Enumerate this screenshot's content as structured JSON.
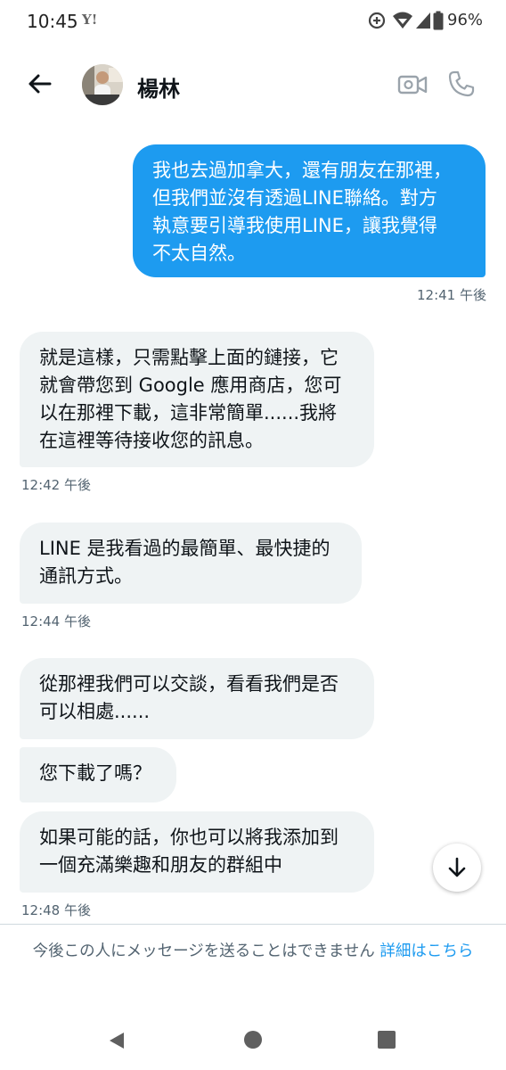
{
  "status_bar": {
    "time": "10:45",
    "carrier_icon_text": "Y!",
    "icons": [
      "data-saver-icon",
      "wifi-icon",
      "signal-icon",
      "battery-icon"
    ],
    "battery": "96%"
  },
  "header": {
    "contact_name": "楊林",
    "icons": {
      "back": "back-arrow-icon",
      "video": "video-call-icon",
      "phone": "phone-icon"
    }
  },
  "messages": [
    {
      "direction": "outgoing",
      "lines": [
        "我也去過加拿大，還有朋友在那裡，",
        "但我們並沒有透過LINE聯絡。對方",
        "執意要引導我使用LINE，讓我覺得",
        "不太自然。"
      ],
      "time": "12:41 午後"
    },
    {
      "direction": "incoming",
      "lines": [
        "就是這樣，只需點擊上面的鏈接，它",
        "就會帶您到 Google 應用商店，您可",
        "以在那裡下載，這非常簡單......我將",
        "在這裡等待接收您的訊息。"
      ],
      "time": "12:42 午後"
    },
    {
      "direction": "incoming",
      "lines": [
        "LINE 是我看過的最簡單、最快捷的",
        "通訊方式。"
      ],
      "time": "12:44 午後"
    },
    {
      "direction": "incoming",
      "lines": [
        "從那裡我們可以交談，看看我們是否",
        "可以相處......"
      ]
    },
    {
      "direction": "incoming",
      "lines": [
        "您下載了嗎？"
      ]
    },
    {
      "direction": "incoming",
      "lines": [
        "如果可能的話，你也可以將我添加到",
        "一個充滿樂趣和朋友的群組中"
      ],
      "time": "12:48 午後"
    }
  ],
  "footer": {
    "notice_text": "今後この人にメッセージを送ることはできません",
    "notice_link": "詳細はこちら"
  },
  "colors": {
    "accent": "#1d9bf0",
    "incoming_bubble": "#eff3f4",
    "secondary_text": "#536471"
  }
}
